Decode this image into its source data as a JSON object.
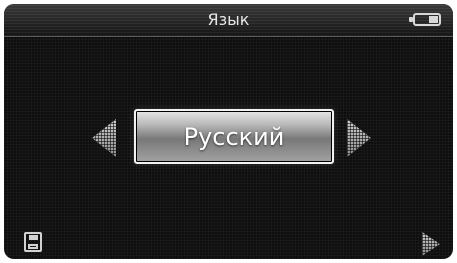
{
  "header": {
    "title": "Язык",
    "battery_icon": "battery-icon"
  },
  "selector": {
    "current_language": "Русский",
    "prev_icon": "arrow-left-icon",
    "next_icon": "arrow-right-icon"
  },
  "footer": {
    "save_icon": "save-icon",
    "next_icon": "next-icon"
  },
  "colors": {
    "background": "#0e0e0e",
    "text": "#e6e6e6",
    "box_border": "#f2f2f2"
  }
}
